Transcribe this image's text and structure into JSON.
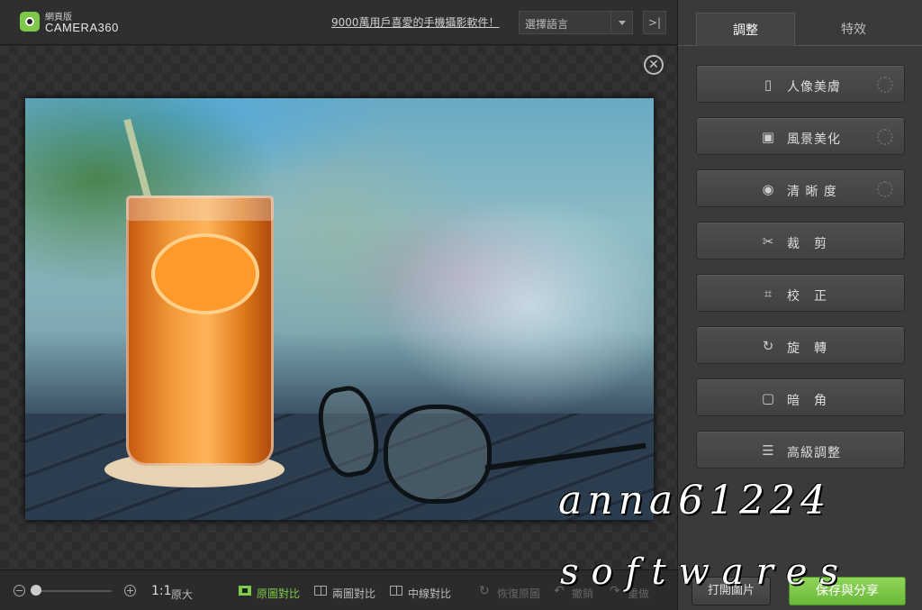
{
  "header": {
    "logo_subtitle": "網頁版",
    "logo_title": "CAMERA360",
    "promo_link": "9000萬用戶喜愛的手機攝影軟件！",
    "language_select": "選擇語言",
    "collapse_icon": "collapse-panel-icon"
  },
  "canvas": {
    "close_icon": "close-icon"
  },
  "toolbar": {
    "zoom_ratio": "1:1",
    "original_size": "原大",
    "compare_original": "原圖對比",
    "compare_two": "兩圖對比",
    "compare_middle": "中線對比",
    "restore": "恢復原圖",
    "undo": "撤銷",
    "redo": "重做",
    "active_color": "#7ec84a"
  },
  "panel": {
    "tabs": [
      {
        "label": "調整",
        "active": true
      },
      {
        "label": "特效",
        "active": false
      }
    ],
    "tools": [
      {
        "label": "人像美膚",
        "icon": "portrait-icon"
      },
      {
        "label": "風景美化",
        "icon": "landscape-icon"
      },
      {
        "label": "清 晰 度",
        "icon": "eye-icon"
      },
      {
        "label": "裁　剪",
        "icon": "scissors-icon"
      },
      {
        "label": "校　正",
        "icon": "crop-correct-icon"
      },
      {
        "label": "旋　轉",
        "icon": "rotate-icon"
      },
      {
        "label": "暗　角",
        "icon": "vignette-icon"
      },
      {
        "label": "高級調整",
        "icon": "sliders-icon"
      }
    ],
    "open_button": "打開圖片",
    "save_button": "保存與分享"
  },
  "watermark": {
    "line1": "anna61224",
    "line2": "softwares"
  }
}
